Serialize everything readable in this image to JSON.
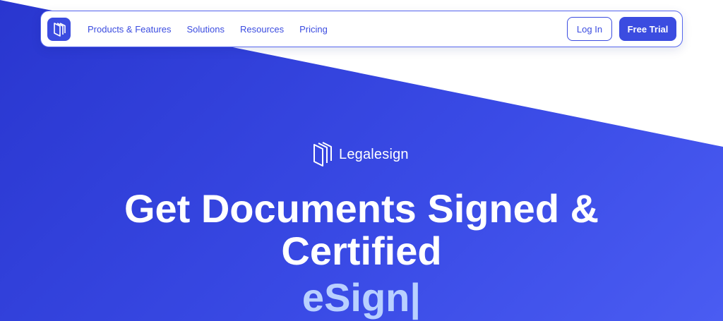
{
  "nav": {
    "logo_icon": "legalesign-mark-icon",
    "links": [
      "Products & Features",
      "Solutions",
      "Resources",
      "Pricing"
    ],
    "login_label": "Log In",
    "trial_label": "Free Trial"
  },
  "hero": {
    "brand_name": "Legalesign",
    "headline_line1": "Get Documents Signed &",
    "headline_line2": "Certified",
    "typed_text": "eSign|"
  },
  "colors": {
    "brand_blue": "#3b4ce0",
    "hero_gradient_start": "#2936cf",
    "hero_gradient_end": "#4a5cf2",
    "typed_text": "#b9d0ff"
  }
}
